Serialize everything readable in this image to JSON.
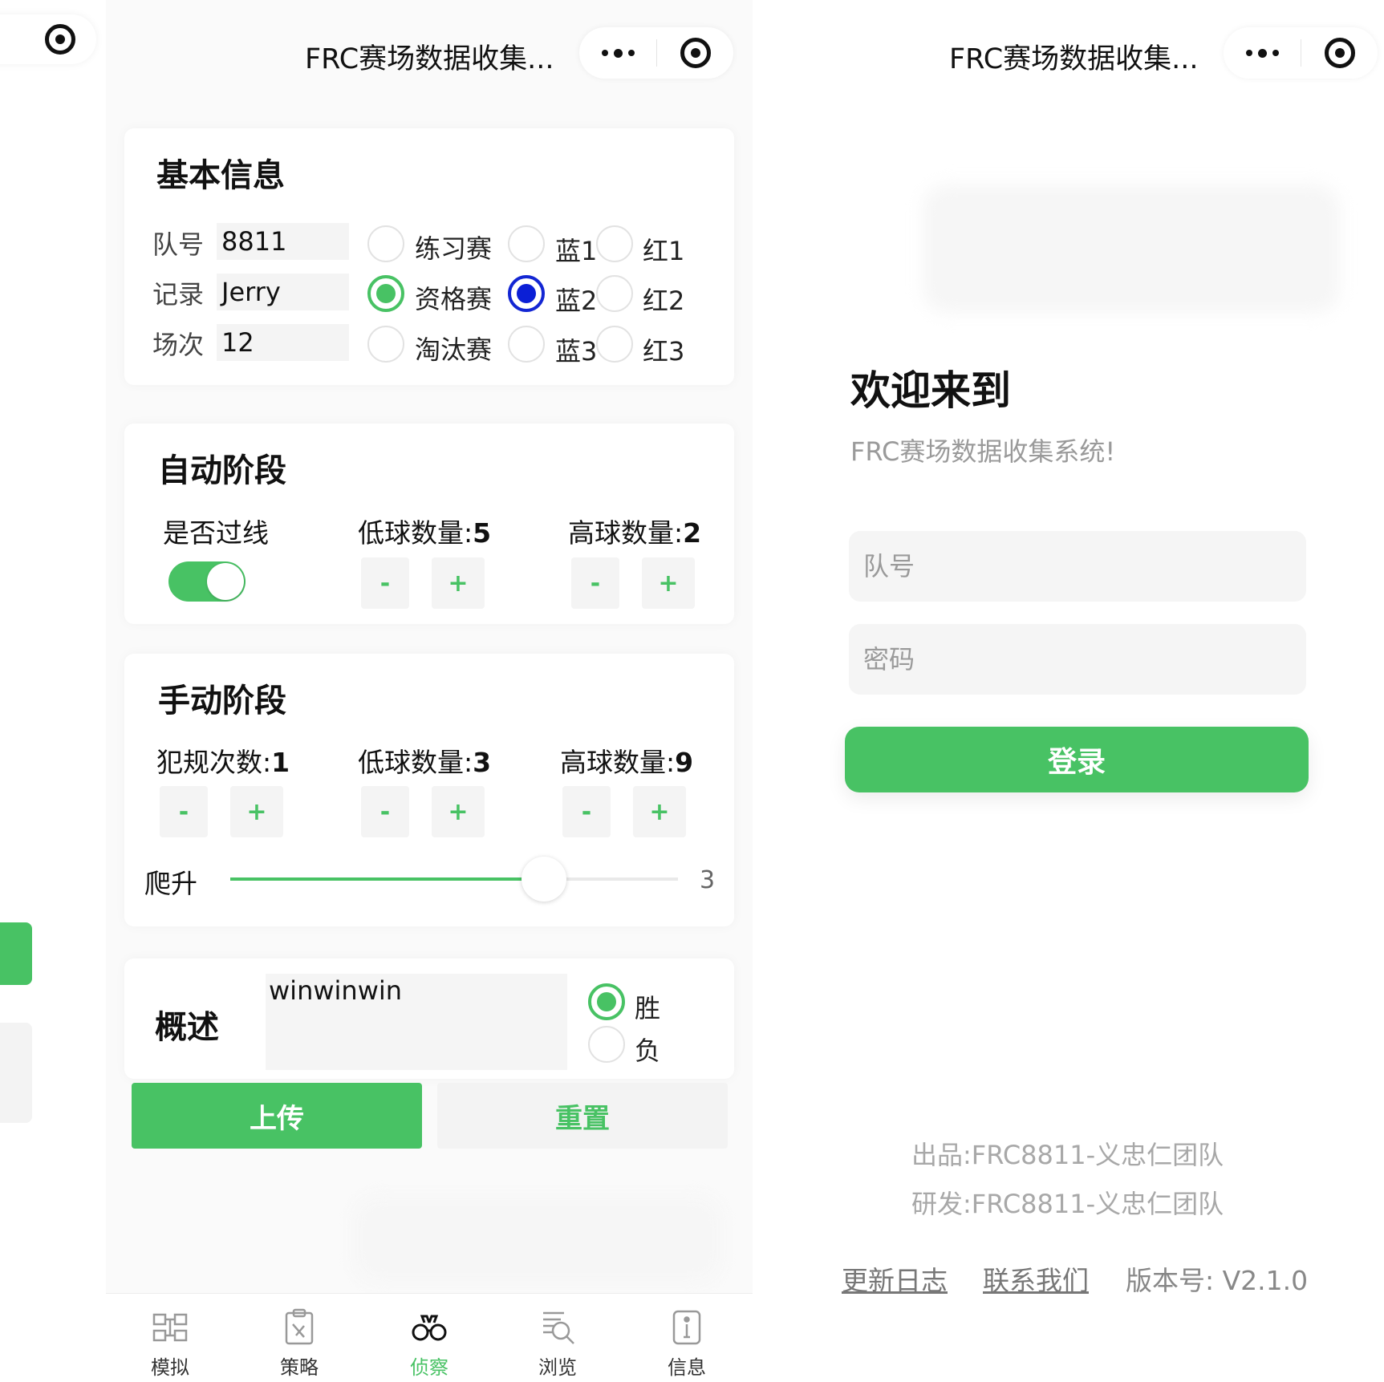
{
  "app_title": "FRC赛场数据收集...",
  "basic_info": {
    "title": "基本信息",
    "team_label": "队号",
    "team_value": "8811",
    "recorder_label": "记录",
    "recorder_value": "Jerry",
    "match_label": "场次",
    "match_value": "12",
    "match_types": [
      "练习赛",
      "资格赛",
      "淘汰赛"
    ],
    "match_type_selected": "资格赛",
    "blue_positions": [
      "蓝1",
      "蓝2",
      "蓝3"
    ],
    "red_positions": [
      "红1",
      "红2",
      "红3"
    ],
    "position_selected": "蓝2"
  },
  "auto": {
    "title": "自动阶段",
    "cross_line_label": "是否过线",
    "cross_line_on": true,
    "low_label": "低球数量:",
    "low_value": "5",
    "high_label": "高球数量:",
    "high_value": "2"
  },
  "teleop": {
    "title": "手动阶段",
    "foul_label": "犯规次数:",
    "foul_value": "1",
    "low_label": "低球数量:",
    "low_value": "3",
    "high_label": "高球数量:",
    "high_value": "9",
    "climb_label": "爬升",
    "climb_value": "3",
    "climb_fraction": 0.7
  },
  "stepper": {
    "minus": "-",
    "plus": "+"
  },
  "summary": {
    "title": "概述",
    "text": "winwinwin",
    "win_label": "胜",
    "lose_label": "负",
    "result_selected": "胜"
  },
  "actions": {
    "upload": "上传",
    "reset": "重置"
  },
  "tabs": [
    {
      "label": "模拟",
      "icon": "simulate-icon"
    },
    {
      "label": "策略",
      "icon": "strategy-icon"
    },
    {
      "label": "侦察",
      "icon": "binoculars-icon",
      "active": true
    },
    {
      "label": "浏览",
      "icon": "browse-icon"
    },
    {
      "label": "信息",
      "icon": "info-icon"
    }
  ],
  "login": {
    "welcome": "欢迎来到",
    "subtitle": "FRC赛场数据收集系统!",
    "team_placeholder": "队号",
    "password_placeholder": "密码",
    "login_button": "登录",
    "credit_producer": "出品:FRC8811-义忠仁团队",
    "credit_developer": "研发:FRC8811-义忠仁团队",
    "changelog": "更新日志",
    "contact": "联系我们",
    "version": "版本号: V2.1.0"
  },
  "colors": {
    "accent": "#48c264",
    "selected_blue": "#0b1fd6"
  }
}
